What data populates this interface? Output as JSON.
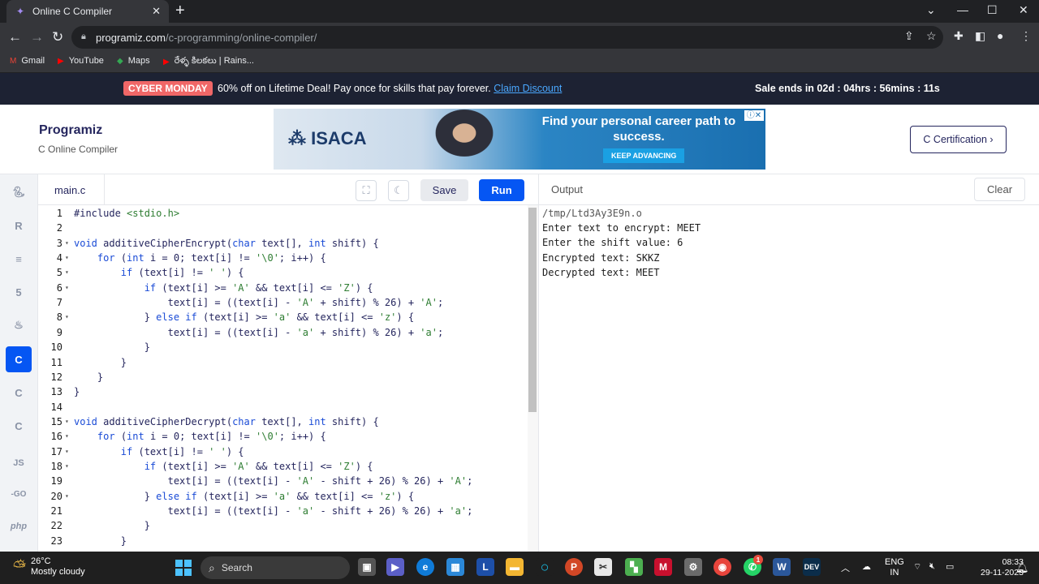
{
  "browser": {
    "tab_title": "Online C Compiler",
    "url_host": "programiz.com",
    "url_path": "/c-programming/online-compiler/",
    "bookmarks": [
      "Gmail",
      "YouTube",
      "Maps",
      "రేళ్ళ కిలకలు | Rains..."
    ]
  },
  "promo": {
    "badge": "CYBER MONDAY",
    "text": "60% off on Lifetime Deal! Pay once for skills that pay forever.",
    "link": "Claim Discount",
    "sale": "Sale ends in 02d : 04hrs : 56mins : 11s"
  },
  "header": {
    "logo": "Programiz",
    "subtitle": "C Online Compiler",
    "ad_brand": "ISACA",
    "ad_headline": "Find your personal career path to success.",
    "ad_cta": "KEEP ADVANCING",
    "cert_button": "C Certification ›"
  },
  "sidebar": {
    "langs": [
      "python-icon",
      "r-icon",
      "sql-icon",
      "html-icon",
      "java-icon",
      "c-icon",
      "cpp-icon",
      "csharp-icon",
      "js-icon",
      "go-icon",
      "php-icon"
    ],
    "active": "c-icon",
    "js": "JS",
    "go": "-GO",
    "php": "php"
  },
  "toolbar": {
    "file": "main.c",
    "save": "Save",
    "run": "Run"
  },
  "output": {
    "title": "Output",
    "clear": "Clear",
    "lines": [
      "/tmp/Ltd3Ay3E9n.o",
      "Enter text to encrypt: MEET",
      "Enter the shift value: 6",
      "Encrypted text: SKKZ",
      "Decrypted text: MEET"
    ]
  },
  "code": [
    {
      "n": "1",
      "f": "",
      "t": "#include <stdio.h>"
    },
    {
      "n": "2",
      "f": "",
      "t": ""
    },
    {
      "n": "3",
      "f": "▾",
      "t": "void additiveCipherEncrypt(char text[], int shift) {"
    },
    {
      "n": "4",
      "f": "▾",
      "t": "    for (int i = 0; text[i] != '\\0'; i++) {"
    },
    {
      "n": "5",
      "f": "▾",
      "t": "        if (text[i] != ' ') {"
    },
    {
      "n": "6",
      "f": "▾",
      "t": "            if (text[i] >= 'A' && text[i] <= 'Z') {"
    },
    {
      "n": "7",
      "f": "",
      "t": "                text[i] = ((text[i] - 'A' + shift) % 26) + 'A';"
    },
    {
      "n": "8",
      "f": "▾",
      "t": "            } else if (text[i] >= 'a' && text[i] <= 'z') {"
    },
    {
      "n": "9",
      "f": "",
      "t": "                text[i] = ((text[i] - 'a' + shift) % 26) + 'a';"
    },
    {
      "n": "10",
      "f": "",
      "t": "            }"
    },
    {
      "n": "11",
      "f": "",
      "t": "        }"
    },
    {
      "n": "12",
      "f": "",
      "t": "    }"
    },
    {
      "n": "13",
      "f": "",
      "t": "}"
    },
    {
      "n": "14",
      "f": "",
      "t": ""
    },
    {
      "n": "15",
      "f": "▾",
      "t": "void additiveCipherDecrypt(char text[], int shift) {"
    },
    {
      "n": "16",
      "f": "▾",
      "t": "    for (int i = 0; text[i] != '\\0'; i++) {"
    },
    {
      "n": "17",
      "f": "▾",
      "t": "        if (text[i] != ' ') {"
    },
    {
      "n": "18",
      "f": "▾",
      "t": "            if (text[i] >= 'A' && text[i] <= 'Z') {"
    },
    {
      "n": "19",
      "f": "",
      "t": "                text[i] = ((text[i] - 'A' - shift + 26) % 26) + 'A';"
    },
    {
      "n": "20",
      "f": "▾",
      "t": "            } else if (text[i] >= 'a' && text[i] <= 'z') {"
    },
    {
      "n": "21",
      "f": "",
      "t": "                text[i] = ((text[i] - 'a' - shift + 26) % 26) + 'a';"
    },
    {
      "n": "22",
      "f": "",
      "t": "            }"
    },
    {
      "n": "23",
      "f": "",
      "t": "        }"
    }
  ],
  "taskbar": {
    "temp": "26°C",
    "weather": "Mostly cloudy",
    "search": "Search",
    "lang1": "ENG",
    "lang2": "IN",
    "time": "08:33",
    "date": "29-11-2023",
    "badge": "1"
  }
}
